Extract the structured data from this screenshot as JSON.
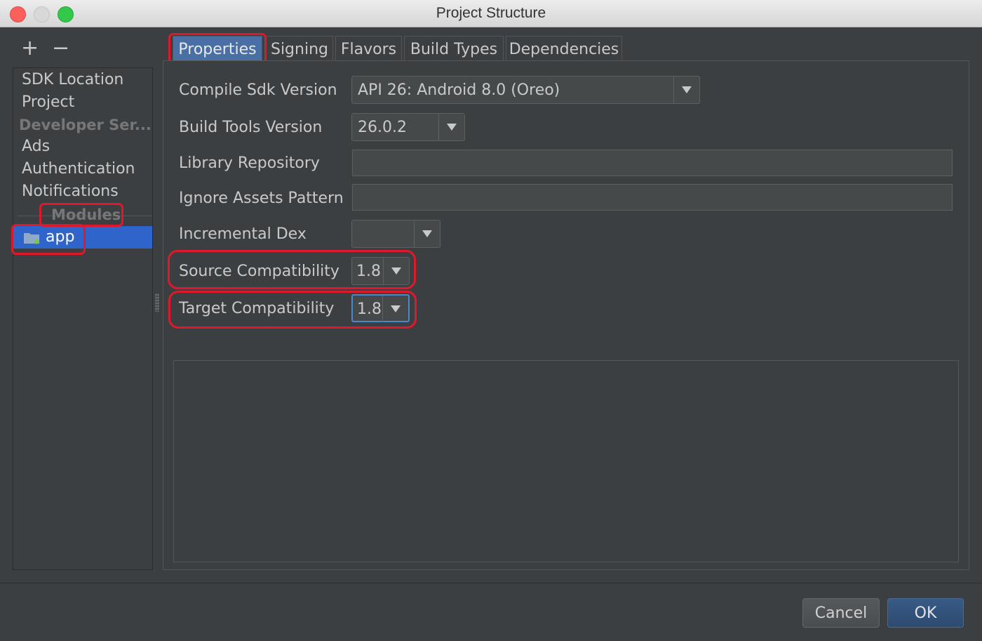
{
  "window": {
    "title": "Project Structure"
  },
  "toolbar": {
    "add_label": "+",
    "remove_label": "−"
  },
  "sidebar": {
    "items": [
      {
        "label": "SDK Location"
      },
      {
        "label": "Project"
      }
    ],
    "developer_header": "Developer Ser...",
    "developer_items": [
      {
        "label": "Ads"
      },
      {
        "label": "Authentication"
      },
      {
        "label": "Notifications"
      }
    ],
    "modules_header": "Modules",
    "selected_module": "app"
  },
  "tabs": [
    {
      "label": "Properties",
      "active": true
    },
    {
      "label": "Signing"
    },
    {
      "label": "Flavors"
    },
    {
      "label": "Build Types"
    },
    {
      "label": "Dependencies"
    }
  ],
  "properties": {
    "compile_sdk": {
      "label": "Compile Sdk Version",
      "value": "API 26: Android 8.0 (Oreo)"
    },
    "build_tools": {
      "label": "Build Tools Version",
      "value": "26.0.2"
    },
    "library_repository": {
      "label": "Library Repository",
      "value": ""
    },
    "ignore_assets": {
      "label": "Ignore Assets Pattern",
      "value": ""
    },
    "incremental_dex": {
      "label": "Incremental Dex",
      "value": ""
    },
    "source_compat": {
      "label": "Source Compatibility",
      "value": "1.8"
    },
    "target_compat": {
      "label": "Target Compatibility",
      "value": "1.8"
    }
  },
  "buttons": {
    "cancel": "Cancel",
    "ok": "OK"
  },
  "colors": {
    "highlight": "#e0182b",
    "selection": "#2f65ca",
    "background": "#3c3f41"
  }
}
